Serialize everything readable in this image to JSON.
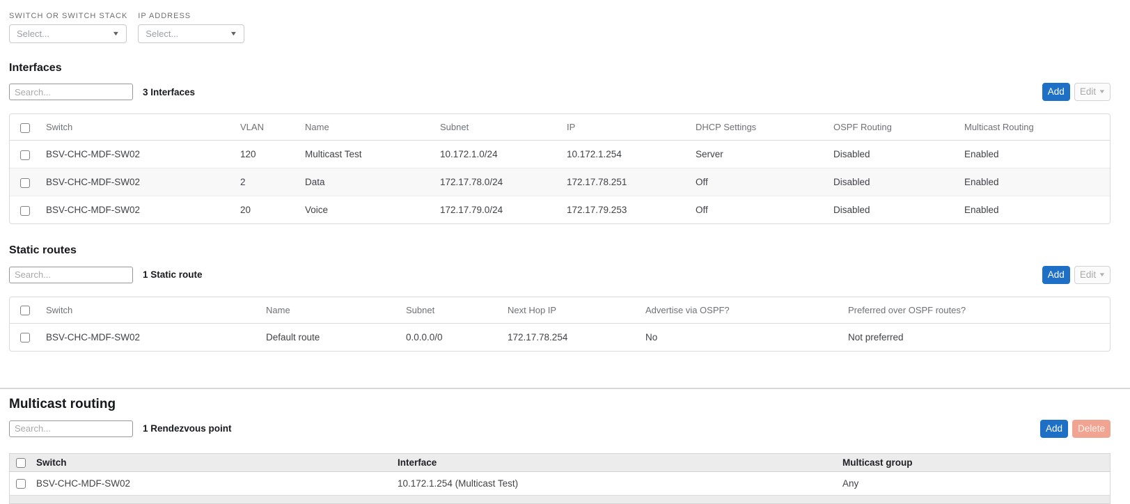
{
  "filters": {
    "switch_label": "SWITCH OR SWITCH STACK",
    "switch_value": "Select...",
    "ip_label": "IP ADDRESS",
    "ip_value": "Select..."
  },
  "interfaces": {
    "title": "Interfaces",
    "search_placeholder": "Search...",
    "count": "3 Interfaces",
    "add_label": "Add",
    "edit_label": "Edit",
    "columns": [
      "Switch",
      "VLAN",
      "Name",
      "Subnet",
      "IP",
      "DHCP Settings",
      "OSPF Routing",
      "Multicast Routing"
    ],
    "rows": [
      {
        "switch": "BSV-CHC-MDF-SW02",
        "vlan": "120",
        "name": "Multicast Test",
        "subnet": "10.172.1.0/24",
        "ip": "10.172.1.254",
        "dhcp": "Server",
        "ospf": "Disabled",
        "multicast": "Enabled"
      },
      {
        "switch": "BSV-CHC-MDF-SW02",
        "vlan": "2",
        "name": "Data",
        "subnet": "172.17.78.0/24",
        "ip": "172.17.78.251",
        "dhcp": "Off",
        "ospf": "Disabled",
        "multicast": "Enabled"
      },
      {
        "switch": "BSV-CHC-MDF-SW02",
        "vlan": "20",
        "name": "Voice",
        "subnet": "172.17.79.0/24",
        "ip": "172.17.79.253",
        "dhcp": "Off",
        "ospf": "Disabled",
        "multicast": "Enabled"
      }
    ]
  },
  "static_routes": {
    "title": "Static routes",
    "search_placeholder": "Search...",
    "count": "1 Static route",
    "add_label": "Add",
    "edit_label": "Edit",
    "columns": [
      "Switch",
      "Name",
      "Subnet",
      "Next Hop IP",
      "Advertise via OSPF?",
      "Preferred over OSPF routes?"
    ],
    "rows": [
      {
        "switch": "BSV-CHC-MDF-SW02",
        "name": "Default route",
        "subnet": "0.0.0.0/0",
        "next_hop": "172.17.78.254",
        "advertise": "No",
        "preferred": "Not preferred"
      }
    ]
  },
  "multicast": {
    "title": "Multicast routing",
    "search_placeholder": "Search...",
    "count": "1 Rendezvous point",
    "add_label": "Add",
    "delete_label": "Delete",
    "columns": [
      "Switch",
      "Interface",
      "Multicast group"
    ],
    "rows": [
      {
        "switch": "BSV-CHC-MDF-SW02",
        "interface": "10.172.1.254 (Multicast Test)",
        "group": "Any"
      }
    ]
  },
  "colors": {
    "accent_blue": "#1d70c6",
    "danger_muted": "#f2a492",
    "header_gray": "#ececec"
  }
}
